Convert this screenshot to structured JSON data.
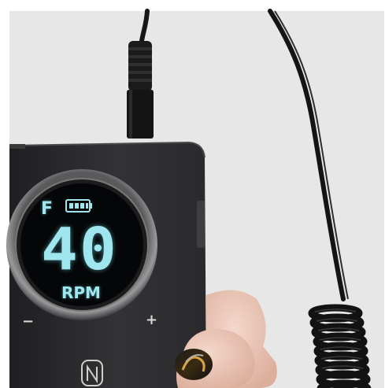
{
  "display": {
    "mode": "F",
    "speed": "40",
    "unit": "RPM"
  },
  "controls": {
    "decrease": "−",
    "increase": "+"
  },
  "icons": {
    "battery": "battery-icon",
    "logo": "brand-logo-icon"
  },
  "colors": {
    "display_text": "#9fe6ee",
    "device_body": "#2b2b2d",
    "background": "#e7e7e7"
  }
}
